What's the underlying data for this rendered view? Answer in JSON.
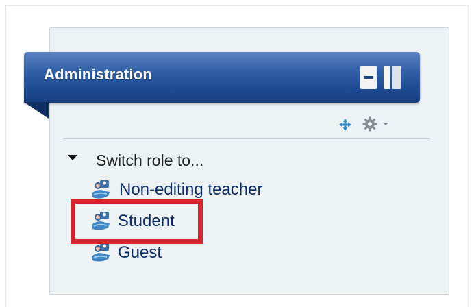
{
  "block": {
    "title": "Administration",
    "header_color": "#1c4a91",
    "controls": {
      "minimize_icon": "minimize-icon",
      "dock_icon": "dock-icon"
    },
    "tools": {
      "move_icon": "move-icon",
      "settings_icon": "gear-icon",
      "dropdown_icon": "caret-down-icon"
    }
  },
  "tree": {
    "section_label": "Switch role to...",
    "toggle_icon": "triangle-down-icon",
    "roles": [
      {
        "label": "Non-editing teacher",
        "icon": "user-role-icon"
      },
      {
        "label": "Student",
        "icon": "user-role-icon",
        "highlighted": true
      },
      {
        "label": "Guest",
        "icon": "user-role-icon"
      }
    ]
  },
  "highlight": {
    "color": "#d8232a",
    "target": "Student"
  }
}
